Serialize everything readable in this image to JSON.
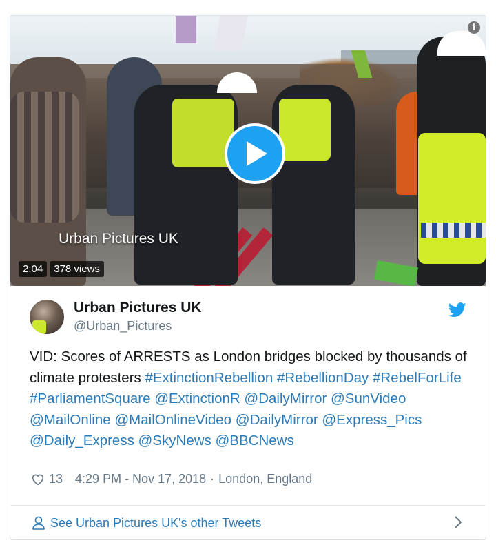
{
  "media": {
    "watermark": "Urban Pictures UK",
    "duration": "2:04",
    "views": "378 views"
  },
  "author": {
    "name": "Urban Pictures UK",
    "handle": "@Urban_Pictures"
  },
  "tweet": {
    "text_plain": "VID: Scores of ARRESTS as London bridges blocked by thousands of climate protesters",
    "hashtags": [
      "#ExtinctionRebellion",
      "#RebellionDay",
      "#RebelForLife",
      "#ParliamentSquare"
    ],
    "mentions": [
      "@ExtinctionR",
      "@DailyMirror",
      "@SunVideo",
      "@MailOnline",
      "@MailOnlineVideo",
      "@DailyMirror",
      "@Express_Pics",
      "@Daily_Express",
      "@SkyNews",
      "@BBCNews"
    ]
  },
  "meta": {
    "likes": "13",
    "time": "4:29 PM - Nov 17, 2018",
    "separator": "·",
    "location": "London, England"
  },
  "footer": {
    "see_more": "See Urban Pictures UK's other Tweets"
  },
  "colors": {
    "link": "#2b7bb9",
    "twitter_blue": "#1da1f2",
    "muted": "#657786"
  },
  "icons": [
    "info-icon",
    "play-icon",
    "twitter-bird-icon",
    "heart-icon",
    "person-icon",
    "chevron-right-icon"
  ]
}
